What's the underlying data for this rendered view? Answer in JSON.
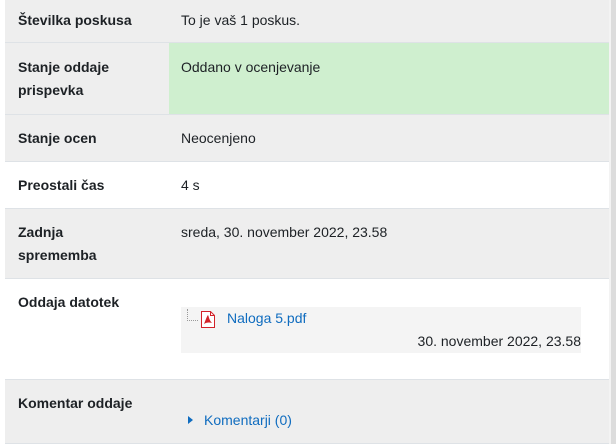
{
  "rows": {
    "attempt": {
      "label": "Številka poskusa",
      "value": "To je vaš 1 poskus."
    },
    "submission_status": {
      "label_line1": "Stanje oddaje",
      "label_line2": "prispevka",
      "value": "Oddano v ocenjevanje"
    },
    "grading_status": {
      "label": "Stanje ocen",
      "value": "Neocenjeno"
    },
    "time_remaining": {
      "label": "Preostali čas",
      "value": "4 s"
    },
    "last_modified": {
      "label_line1": "Zadnja",
      "label_line2": "sprememba",
      "value": "sreda, 30. november 2022, 23.58"
    },
    "file_submissions": {
      "label": "Oddaja datotek",
      "file": {
        "name": "Naloga 5.pdf",
        "icon": "pdf-icon",
        "date": "30. november 2022, 23.58"
      }
    },
    "submission_comments": {
      "label": "Komentar oddaje",
      "toggle": "Komentarji (0)",
      "icon": "caret-right-icon"
    }
  },
  "colors": {
    "link": "#0f6cbf",
    "submitted_bg": "#cfefcf",
    "shaded_row": "#eeeeee",
    "pdf_red": "#d2232a"
  }
}
